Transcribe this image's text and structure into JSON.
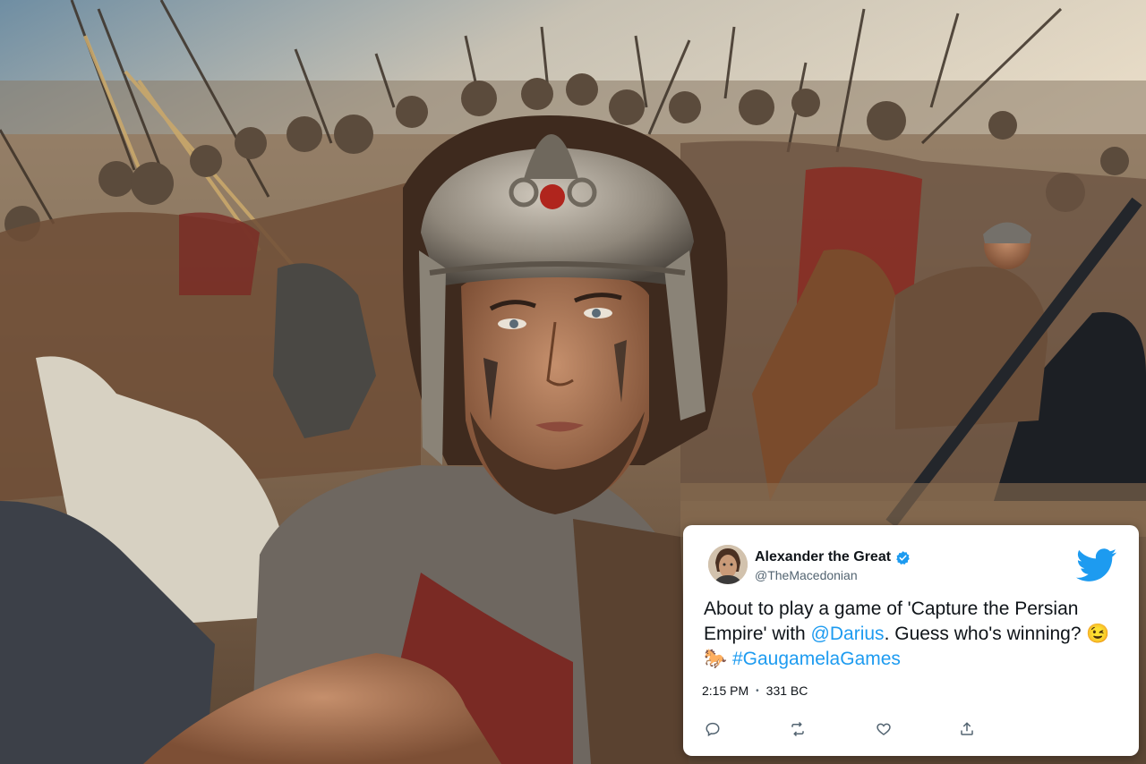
{
  "tweet": {
    "author_name": "Alexander the Great",
    "author_handle": "@TheMacedonian",
    "verified": true,
    "text_prefix": "About to play a game of 'Capture the Persian Empire' with ",
    "mention": "@Darius",
    "text_middle": ". Guess who's winning? 😉🐎 ",
    "hashtag": "#GaugamelaGames",
    "time": "2:15 PM",
    "separator": "•",
    "date": "331 BC"
  },
  "icons": {
    "verified": "verified-badge-icon",
    "brand": "twitter-bird-icon",
    "reply": "reply-icon",
    "retweet": "retweet-icon",
    "like": "like-icon",
    "share": "share-icon"
  },
  "colors": {
    "link": "#1d9bf0",
    "brand": "#1d9bf0",
    "text": "#0f1419",
    "muted": "#536471",
    "card_bg": "#ffffff"
  }
}
